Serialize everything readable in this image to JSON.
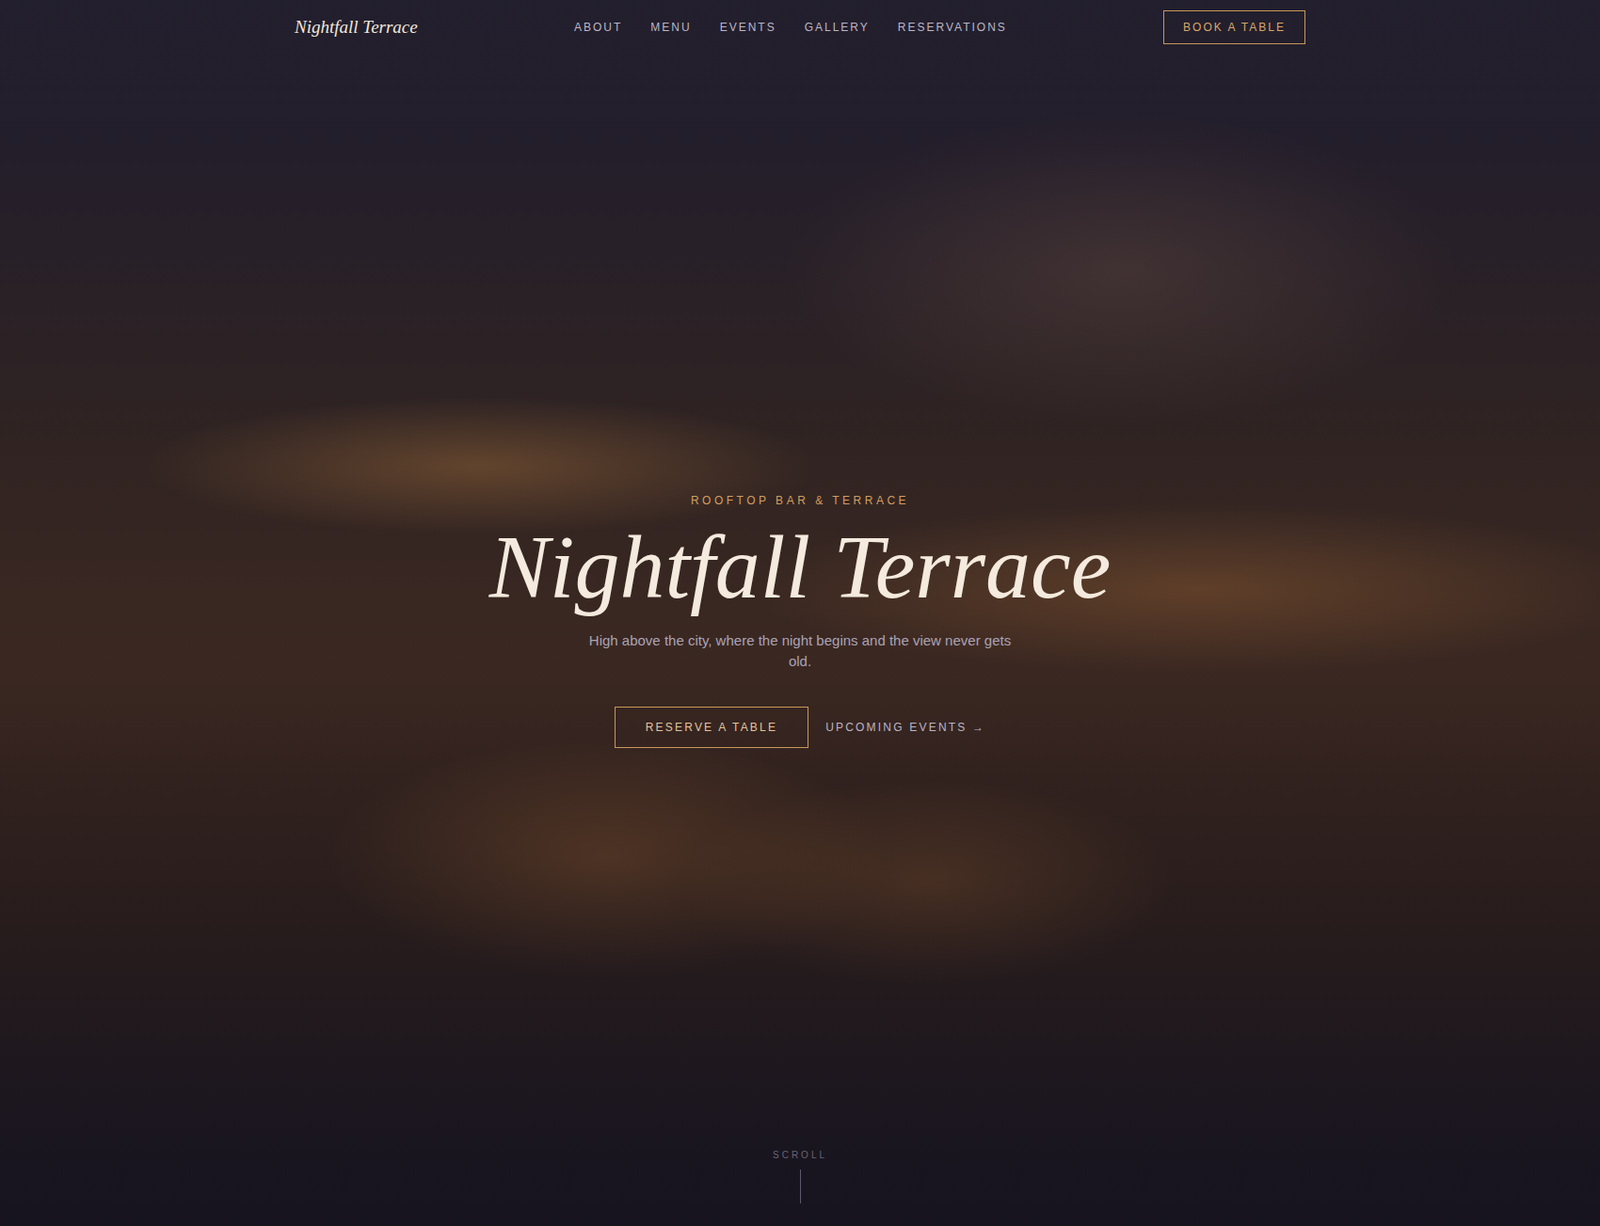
{
  "nav": {
    "logo": "Nightfall Terrace",
    "links": [
      {
        "label": "ABOUT"
      },
      {
        "label": "MENU"
      },
      {
        "label": "EVENTS"
      },
      {
        "label": "GALLERY"
      },
      {
        "label": "RESERVATIONS"
      }
    ],
    "cta": "BOOK A TABLE"
  },
  "hero": {
    "eyebrow": "ROOFTOP BAR & TERRACE",
    "title": "Nightfall Terrace",
    "subtitle": "High above the city, where the night begins and the view never gets old.",
    "primary_button": "RESERVE A TABLE",
    "secondary_link": "UPCOMING EVENTS →",
    "scroll_label": "SCROLL"
  }
}
